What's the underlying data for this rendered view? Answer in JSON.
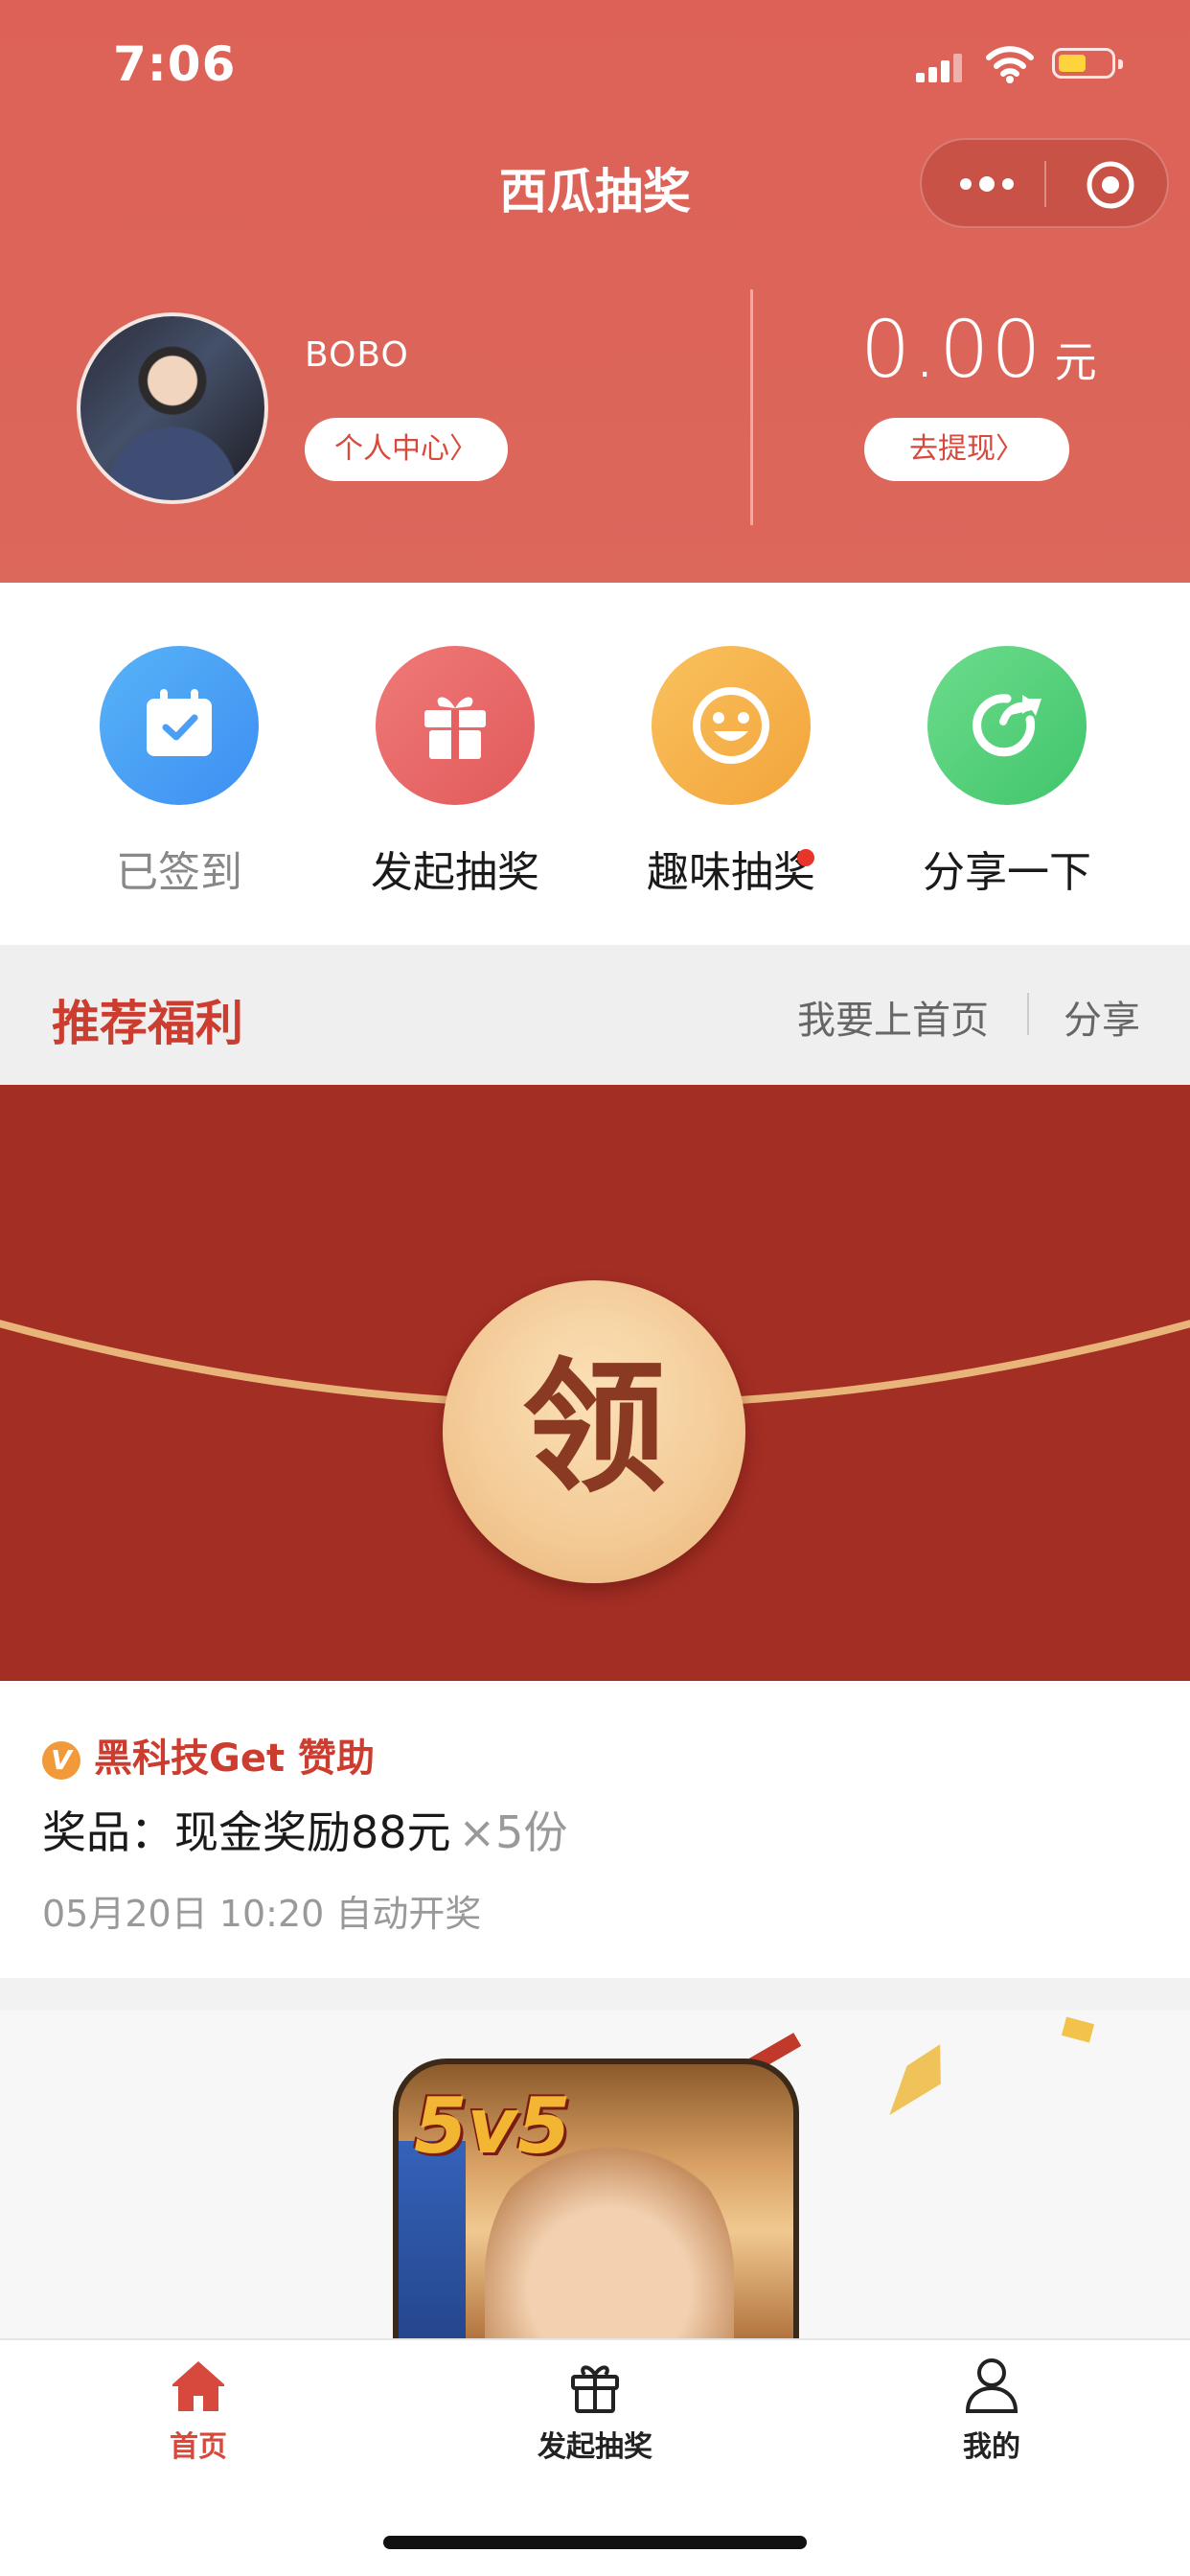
{
  "status_bar": {
    "time": "7:06"
  },
  "nav": {
    "title": "西瓜抽奖"
  },
  "user": {
    "name": "BOBO",
    "profile_button": "个人中心〉"
  },
  "wallet": {
    "amount": "0.00",
    "unit": "元",
    "withdraw_button": "去提现〉"
  },
  "actions": [
    {
      "label": "已签到",
      "icon": "calendar-check-icon",
      "color": "#4a9ff5",
      "state": "done"
    },
    {
      "label": "发起抽奖",
      "icon": "gift-icon",
      "color": "#e5605f"
    },
    {
      "label": "趣味抽奖",
      "icon": "smile-icon",
      "color": "#f5ae45",
      "badge": true
    },
    {
      "label": "分享一下",
      "icon": "share-arrow-icon",
      "color": "#4ccb76"
    }
  ],
  "section": {
    "title": "推荐福利",
    "link_home": "我要上首页",
    "link_share": "分享"
  },
  "banner": {
    "seal_char": "领"
  },
  "prize_card": {
    "sponsor_badge": "V",
    "sponsor": "黑科技Get  赞助",
    "prize": "奖品：现金奖励88元",
    "quantity": "×5份",
    "draw_time": "05月20日 10:20 自动开奖"
  },
  "game_banner": {
    "logo": "5v5"
  },
  "tabbar": [
    {
      "label": "首页",
      "icon": "home-icon",
      "active": true
    },
    {
      "label": "发起抽奖",
      "icon": "gift-icon"
    },
    {
      "label": "我的",
      "icon": "user-icon"
    }
  ],
  "colors": {
    "brand_red": "#dc5f55",
    "accent_red": "#cc3d2f",
    "banner_red": "#a32e24"
  }
}
